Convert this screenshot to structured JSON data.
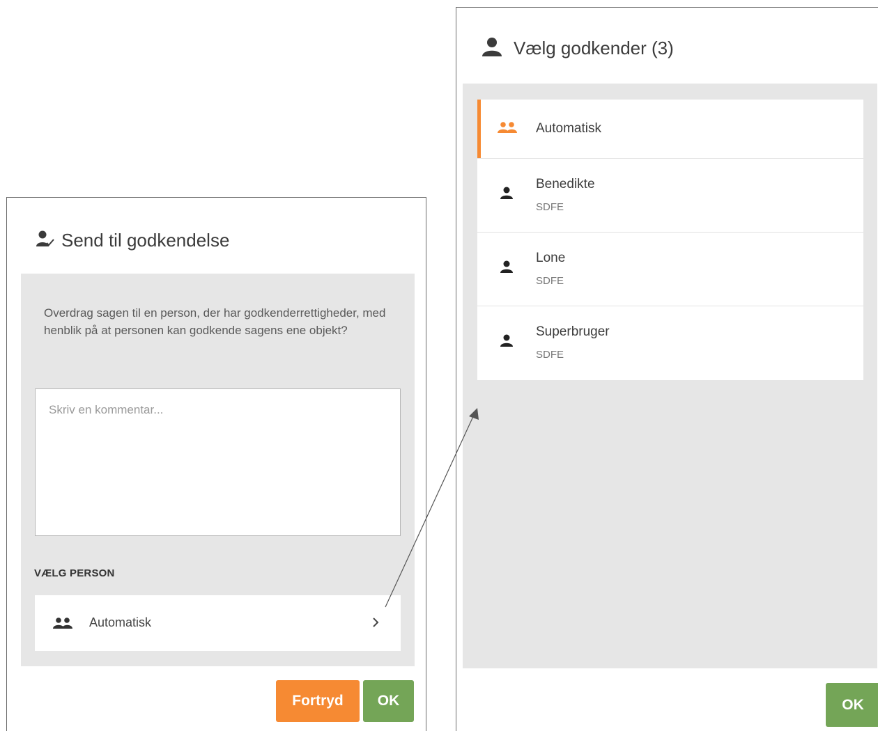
{
  "left_dialog": {
    "title": "Send til godkendelse",
    "title_icon": "person-check-icon",
    "description": "Overdrag sagen til en person, der har godkenderrettigheder, med henblik på at personen kan godkende sagens ene objekt?",
    "comment": {
      "placeholder": "Skriv en kommentar...",
      "value": ""
    },
    "section_label": "VÆLG PERSON",
    "selected_person": {
      "label": "Automatisk",
      "icon": "group-icon"
    },
    "buttons": {
      "cancel": "Fortryd",
      "ok": "OK"
    }
  },
  "right_dialog": {
    "title": "Vælg godkender (3)",
    "title_icon": "person-icon",
    "items": [
      {
        "name": "Automatisk",
        "org": "",
        "icon": "group-icon",
        "selected": true
      },
      {
        "name": "Benedikte",
        "org": "SDFE",
        "icon": "person-icon",
        "selected": false
      },
      {
        "name": "Lone",
        "org": "SDFE",
        "icon": "person-icon",
        "selected": false
      },
      {
        "name": "Superbruger",
        "org": "SDFE",
        "icon": "person-icon",
        "selected": false
      }
    ],
    "buttons": {
      "ok": "OK"
    }
  },
  "colors": {
    "accent_orange": "#f68a33",
    "ok_green": "#74a557",
    "panel_gray": "#e6e6e6"
  }
}
